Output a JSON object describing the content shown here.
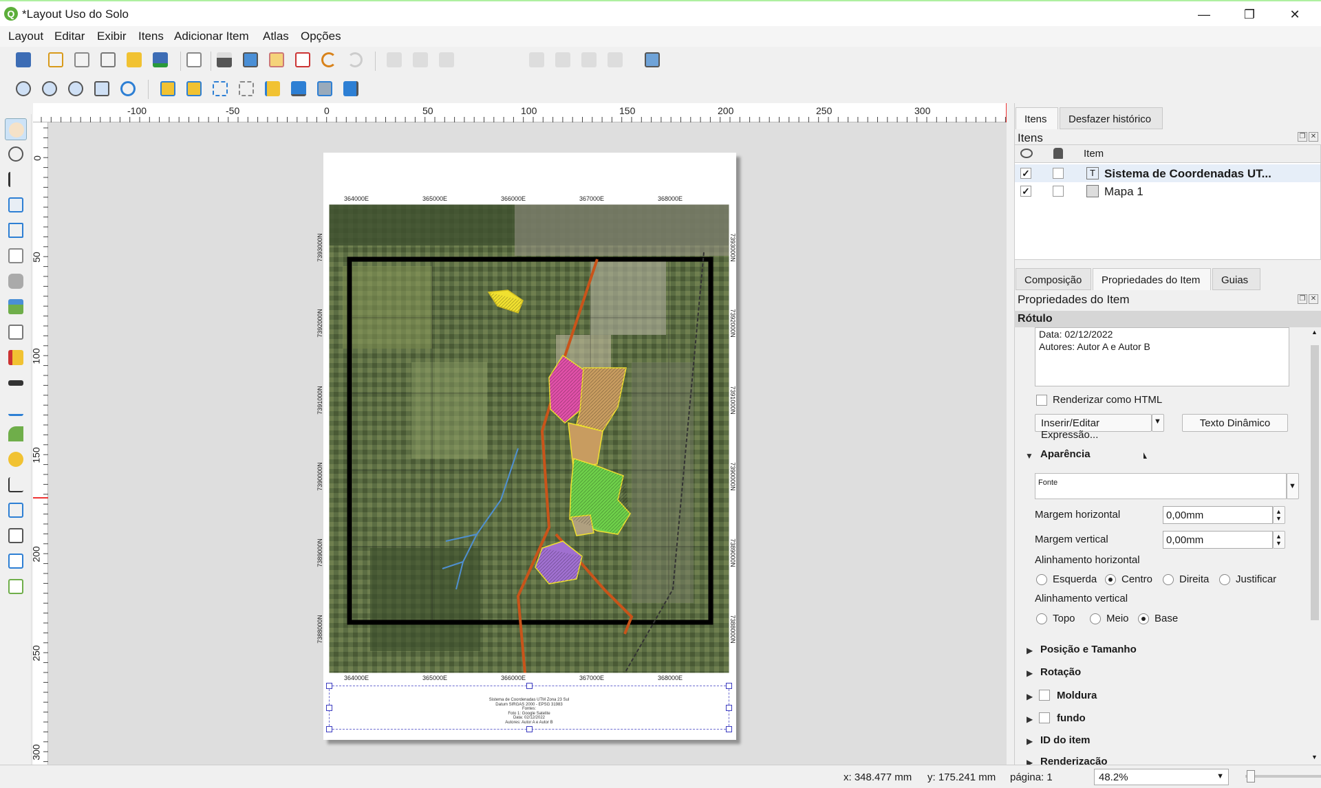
{
  "window": {
    "title": "*Layout Uso do Solo",
    "app_icon": "qgis-icon",
    "min": "—",
    "max": "❐",
    "close": "✕"
  },
  "menu": [
    "Layout",
    "Editar",
    "Exibir",
    "Itens",
    "Adicionar Item",
    "Atlas",
    "Opções"
  ],
  "toolbar": {
    "page_number": "1"
  },
  "rulers": {
    "h": [
      "-100",
      "-50",
      "0",
      "50",
      "100",
      "150",
      "200",
      "250",
      "300"
    ],
    "v": [
      "0",
      "50",
      "100",
      "150",
      "200",
      "250",
      "300"
    ]
  },
  "map": {
    "top_coords": [
      "364000E",
      "365000E",
      "366000E",
      "367000E",
      "368000E"
    ],
    "bottom_coords": [
      "364000E",
      "365000E",
      "366000E",
      "367000E",
      "368000E"
    ],
    "left_coords": [
      "7393000N",
      "7392000N",
      "7391000N",
      "7390000N",
      "7389000N",
      "7388000N"
    ],
    "right_coords": [
      "7393000N",
      "7392000N",
      "7391000N",
      "7390000N",
      "7389000N",
      "7388000N"
    ]
  },
  "map_label_lines": [
    "Sistema de Coordenadas UTM Zona 23 Sul",
    "Datum SIRGAS 2000 - EPSG 31983",
    "Fontes:",
    "Foto 1: Google Satelite",
    "Data: 02/12/2022",
    "Autores: Autor A e Autor B"
  ],
  "panel": {
    "tabs_top": [
      "Itens",
      "Desfazer histórico"
    ],
    "items_title": "Itens",
    "items_header": "Item",
    "items": [
      {
        "name": "Sistema de Coordenadas UT...",
        "visible": "✓",
        "icon": "text-item-icon"
      },
      {
        "name": "Mapa 1",
        "visible": "✓",
        "icon": "map-item-icon"
      }
    ],
    "tabs_bottom": [
      "Composição",
      "Propriedades do Item",
      "Guias"
    ],
    "props_title": "Propriedades do Item",
    "section": "Rótulo",
    "label_text": "Data: 02/12/2022\nAutores: Autor A e Autor B",
    "render_html": "Renderizar como HTML",
    "insert_expr": "Inserir/Editar Expressão...",
    "dynamic_text": "Texto Dinâmico",
    "appearance": "Aparência",
    "font": "Fonte",
    "margin_h_label": "Margem horizontal",
    "margin_h": "0,00mm",
    "margin_v_label": "Margem vertical",
    "margin_v": "0,00mm",
    "align_h_label": "Alinhamento horizontal",
    "align_h_options": [
      "Esquerda",
      "Centro",
      "Direita",
      "Justificar"
    ],
    "align_h_selected": "Centro",
    "align_v_label": "Alinhamento vertical",
    "align_v_options": [
      "Topo",
      "Meio",
      "Base"
    ],
    "align_v_selected": "Base",
    "collapsed": [
      "Posição e Tamanho",
      "Rotação",
      "Moldura",
      "fundo",
      "ID do item",
      "Renderização"
    ]
  },
  "status": {
    "x": "x: 348.477 mm",
    "y": "y: 175.241 mm",
    "page": "página: 1",
    "zoom": "48.2%"
  }
}
